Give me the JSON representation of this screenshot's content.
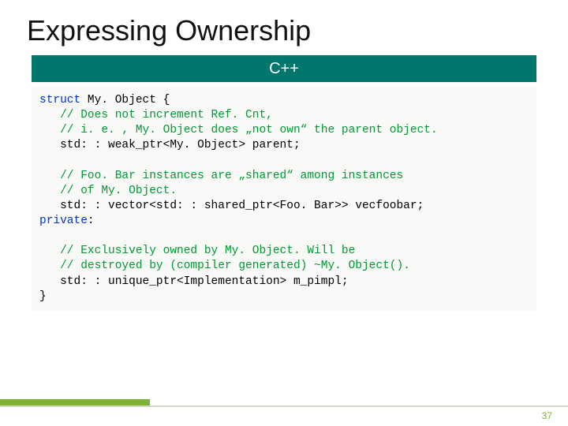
{
  "title": "Expressing Ownership",
  "banner": "C++",
  "code": {
    "l1a": "struct",
    "l1b": " My. Object {",
    "l2": "   // Does not increment Ref. Cnt,",
    "l3": "   // i. e. , My. Object does „not own“ the parent object.",
    "l4": "   std: : weak_ptr<My. Object> parent;",
    "l5": "",
    "l6": "   // Foo. Bar instances are „shared“ among instances",
    "l7": "   // of My. Object.",
    "l8": "   std: : vector<std: : shared_ptr<Foo. Bar>> vecfoobar;",
    "l9a": "private",
    "l9b": ":",
    "l10": "",
    "l11": "   // Exclusively owned by My. Object. Will be",
    "l12": "   // destroyed by (compiler generated) ~My. Object().",
    "l13": "   std: : unique_ptr<Implementation> m_pimpl;",
    "l14": "}"
  },
  "page_number": "37"
}
